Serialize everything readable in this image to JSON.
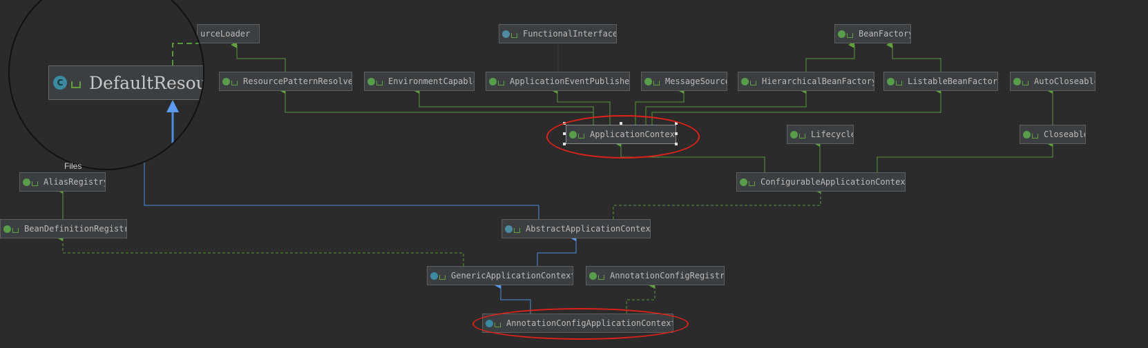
{
  "nodes": {
    "resource_loader": "urceLoader",
    "functional_interface": "FunctionalInterface",
    "bean_factory": "BeanFactory",
    "resource_pattern_resolver": "ResourcePatternResolver",
    "environment_capable": "EnvironmentCapable",
    "application_event_publisher": "ApplicationEventPublisher",
    "message_source": "MessageSource",
    "hierarchical_bean_factory": "HierarchicalBeanFactory",
    "listable_bean_factory": "ListableBeanFactory",
    "auto_closeable": "AutoCloseable",
    "application_context": "ApplicationContext",
    "lifecycle": "Lifecycle",
    "closeable": "Closeable",
    "configurable_application_context": "ConfigurableApplicationContext",
    "alias_registry": "AliasRegistry",
    "bean_definition_registry": "BeanDefinitionRegistry",
    "abstract_application_context": "AbstractApplicationContext",
    "generic_application_context": "GenericApplicationContext",
    "annotation_config_registry": "AnnotationConfigRegistry",
    "annotation_config_application_context": "AnnotationConfigApplicationContext"
  },
  "magnifier": {
    "class_name": "DefaultResour",
    "icon_letter": "C",
    "label": "Files"
  },
  "highlighted": [
    "ApplicationContext",
    "AnnotationConfigApplicationContext"
  ],
  "colors": {
    "background": "#2b2b2b",
    "interface_edge": "#5a9a3e",
    "extends_edge": "#4a90e2",
    "dependency_edge": "#5a9a3e",
    "highlight_oval": "#e0221a"
  }
}
